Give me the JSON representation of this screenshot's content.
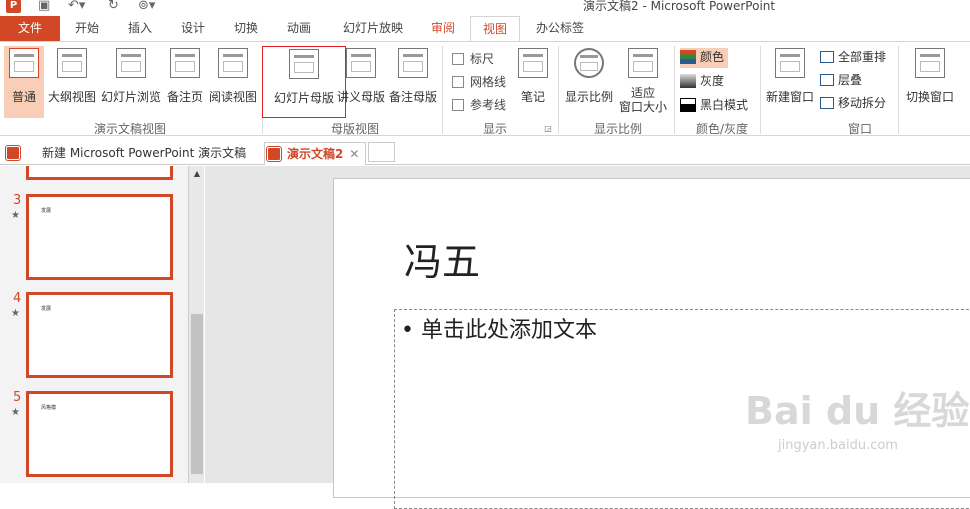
{
  "title_bar": {
    "window_title": "演示文稿2 - Microsoft PowerPoint"
  },
  "menu_tabs": [
    "文件",
    "开始",
    "插入",
    "设计",
    "切换",
    "动画",
    "幻灯片放映",
    "审阅",
    "视图",
    "办公标签"
  ],
  "ribbon": {
    "presentation_views": {
      "normal": "普通",
      "outline": "大纲视图",
      "slide_sorter": "幻灯片浏览",
      "notes_page": "备注页",
      "reading": "阅读视图",
      "group": "演示文稿视图"
    },
    "master_views": {
      "slide_master": "幻灯片母版",
      "handout_master": "讲义母版",
      "notes_master": "备注母版",
      "group": "母版视图"
    },
    "show": {
      "ruler": "标尺",
      "gridlines": "网格线",
      "guides": "参考线",
      "notes": "笔记",
      "group": "显示"
    },
    "zoom": {
      "zoom": "显示比例",
      "fit_line1": "适应",
      "fit_line2": "窗口大小",
      "group": "显示比例"
    },
    "color": {
      "color": "颜色",
      "grayscale": "灰度",
      "bw": "黑白模式",
      "group": "颜色/灰度"
    },
    "window": {
      "new_window": "新建窗口",
      "arrange_all": "全部重排",
      "cascade": "层叠",
      "move_split": "移动拆分",
      "switch": "切换窗口",
      "group": "窗口"
    }
  },
  "doc_tabs": [
    {
      "name": "新建 Microsoft PowerPoint 演示文稿"
    },
    {
      "name": "演示文稿2",
      "close": "✕"
    }
  ],
  "thumbnails": [
    {
      "num": "3",
      "star": "★",
      "text": "发展"
    },
    {
      "num": "4",
      "star": "★",
      "text": "发展"
    },
    {
      "num": "5",
      "star": "★",
      "text": "风格模"
    }
  ],
  "slide": {
    "title": "冯五",
    "bullet": "• 单击此处添加文本"
  },
  "watermark": {
    "brand": "Bai du 经验",
    "url": "jingyan.baidu.com"
  },
  "colors": {
    "accent": "#d24726"
  }
}
